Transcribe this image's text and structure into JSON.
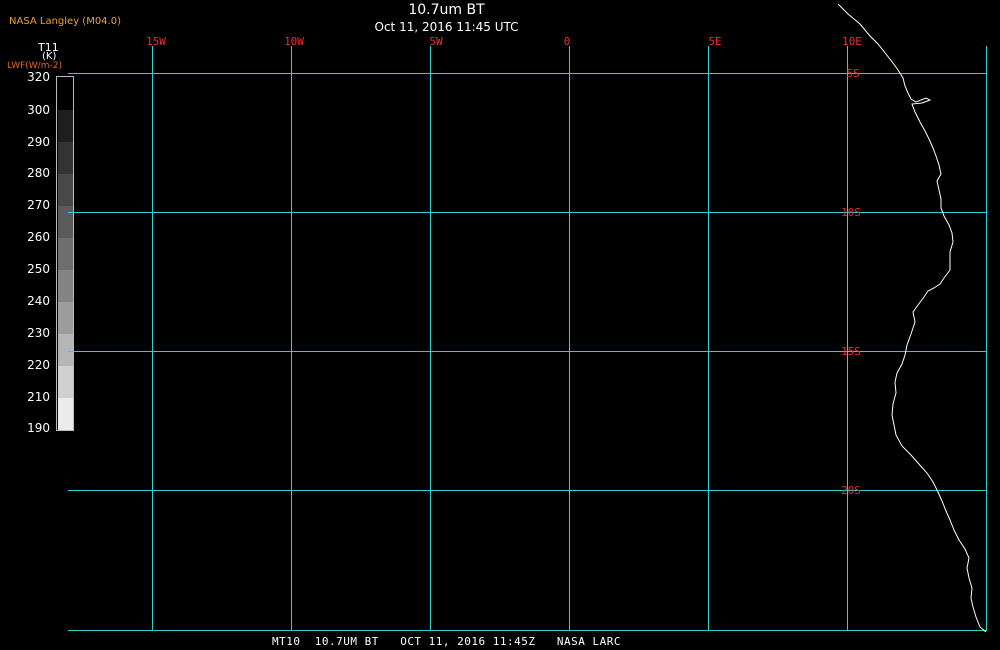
{
  "brand": "NASA Langley (M04.0)",
  "title": "10.7um BT",
  "subtitle": "Oct 11, 2016 11:45 UTC",
  "colorbar": {
    "label": "T11",
    "unit": "(K)",
    "secondary_label": "LWF(W/m-2)",
    "ticks": [
      "320",
      "300",
      "290",
      "280",
      "270",
      "260",
      "250",
      "240",
      "230",
      "220",
      "210",
      "190"
    ]
  },
  "longitude_labels": [
    "15W",
    "10W",
    "5W",
    "0",
    "5E",
    "10E"
  ],
  "latitude_labels": [
    "5S",
    "10S",
    "15S",
    "20S"
  ],
  "footer": "MT10  10.7UM BT   OCT 11, 2016 11:45Z   NASA LARC",
  "colors": {
    "grid": "#2fd0d0",
    "grid_label": "#e83030",
    "coastline": "#ffffff",
    "brand": "#e8a23a"
  }
}
